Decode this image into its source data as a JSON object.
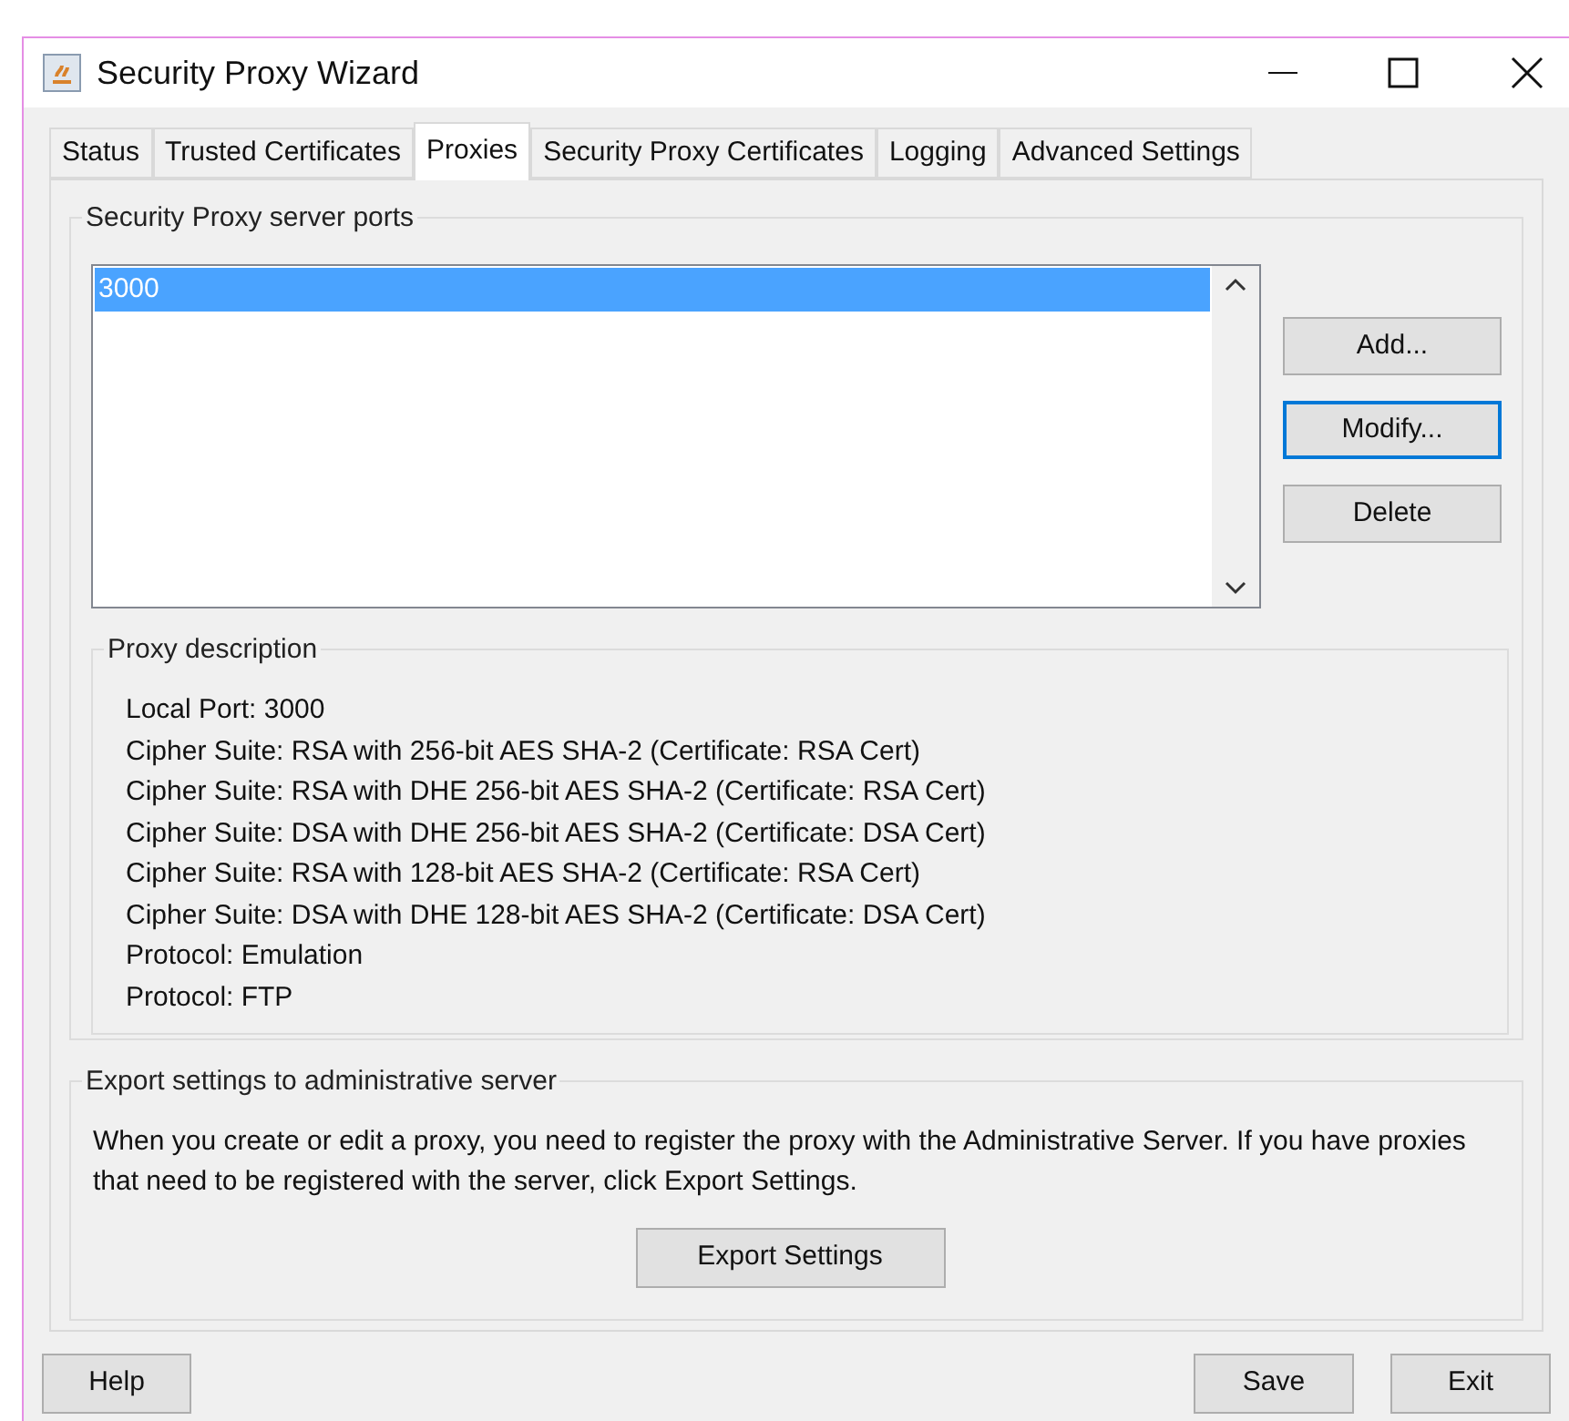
{
  "window": {
    "title": "Security Proxy Wizard"
  },
  "tabs": [
    {
      "label": "Status",
      "selected": false
    },
    {
      "label": "Trusted Certificates",
      "selected": false
    },
    {
      "label": "Proxies",
      "selected": true
    },
    {
      "label": "Security Proxy Certificates",
      "selected": false
    },
    {
      "label": "Logging",
      "selected": false
    },
    {
      "label": "Advanced Settings",
      "selected": false
    }
  ],
  "ports": {
    "title": "Security Proxy server ports",
    "items": [
      {
        "label": "3000",
        "selected": true
      }
    ],
    "buttons": [
      {
        "label": "Add...",
        "focused": false
      },
      {
        "label": "Modify...",
        "focused": true
      },
      {
        "label": "Delete",
        "focused": false
      }
    ]
  },
  "description": {
    "title": "Proxy description",
    "lines": [
      "Local Port: 3000",
      "Cipher Suite: RSA with 256-bit AES SHA-2 (Certificate: RSA Cert)",
      "Cipher Suite: RSA with DHE 256-bit AES SHA-2 (Certificate: RSA Cert)",
      "Cipher Suite: DSA with DHE 256-bit AES SHA-2 (Certificate: DSA Cert)",
      "Cipher Suite: RSA with 128-bit AES SHA-2 (Certificate: RSA Cert)",
      "Cipher Suite: DSA with DHE 128-bit AES SHA-2 (Certificate: DSA Cert)",
      "Protocol: Emulation",
      "Protocol: FTP"
    ]
  },
  "export": {
    "title": "Export settings to administrative server",
    "text": "When you create or edit a proxy, you need to register the proxy with the Administrative Server. If you have proxies that need to be registered with the server, click Export Settings.",
    "button": "Export Settings"
  },
  "footer": {
    "left": [
      "Help"
    ],
    "right": [
      "Save",
      "Exit"
    ]
  }
}
